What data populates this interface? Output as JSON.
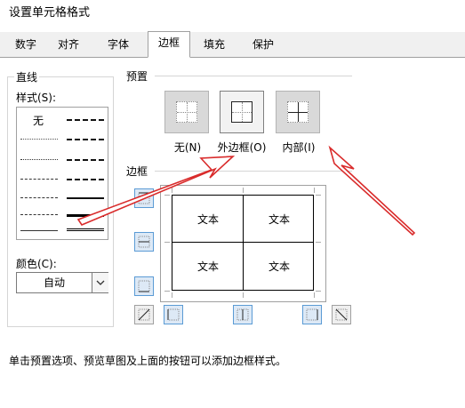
{
  "dialog": {
    "title": "设置单元格格式"
  },
  "tabs": [
    {
      "label": "数字"
    },
    {
      "label": "对齐"
    },
    {
      "label": "字体"
    },
    {
      "label": "边框"
    },
    {
      "label": "填充"
    },
    {
      "label": "保护"
    }
  ],
  "active_tab": "边框",
  "line_section": {
    "heading": "直线",
    "style_label": "样式(S):",
    "style_none": "无",
    "color_label": "颜色(C):",
    "color_value": "自动"
  },
  "presets": {
    "heading": "预置",
    "items": [
      {
        "label": "无(N)"
      },
      {
        "label": "外边框(O)"
      },
      {
        "label": "内部(I)"
      }
    ]
  },
  "border": {
    "heading": "边框",
    "cells": [
      "文本",
      "文本",
      "文本",
      "文本"
    ]
  },
  "hint": "单击预置选项、预览草图及上面的按钮可以添加边框样式。",
  "colors": {
    "accent": "#5b9bd5",
    "arrow": "#d92b2b",
    "tab_bg": "#f0f0f0"
  }
}
